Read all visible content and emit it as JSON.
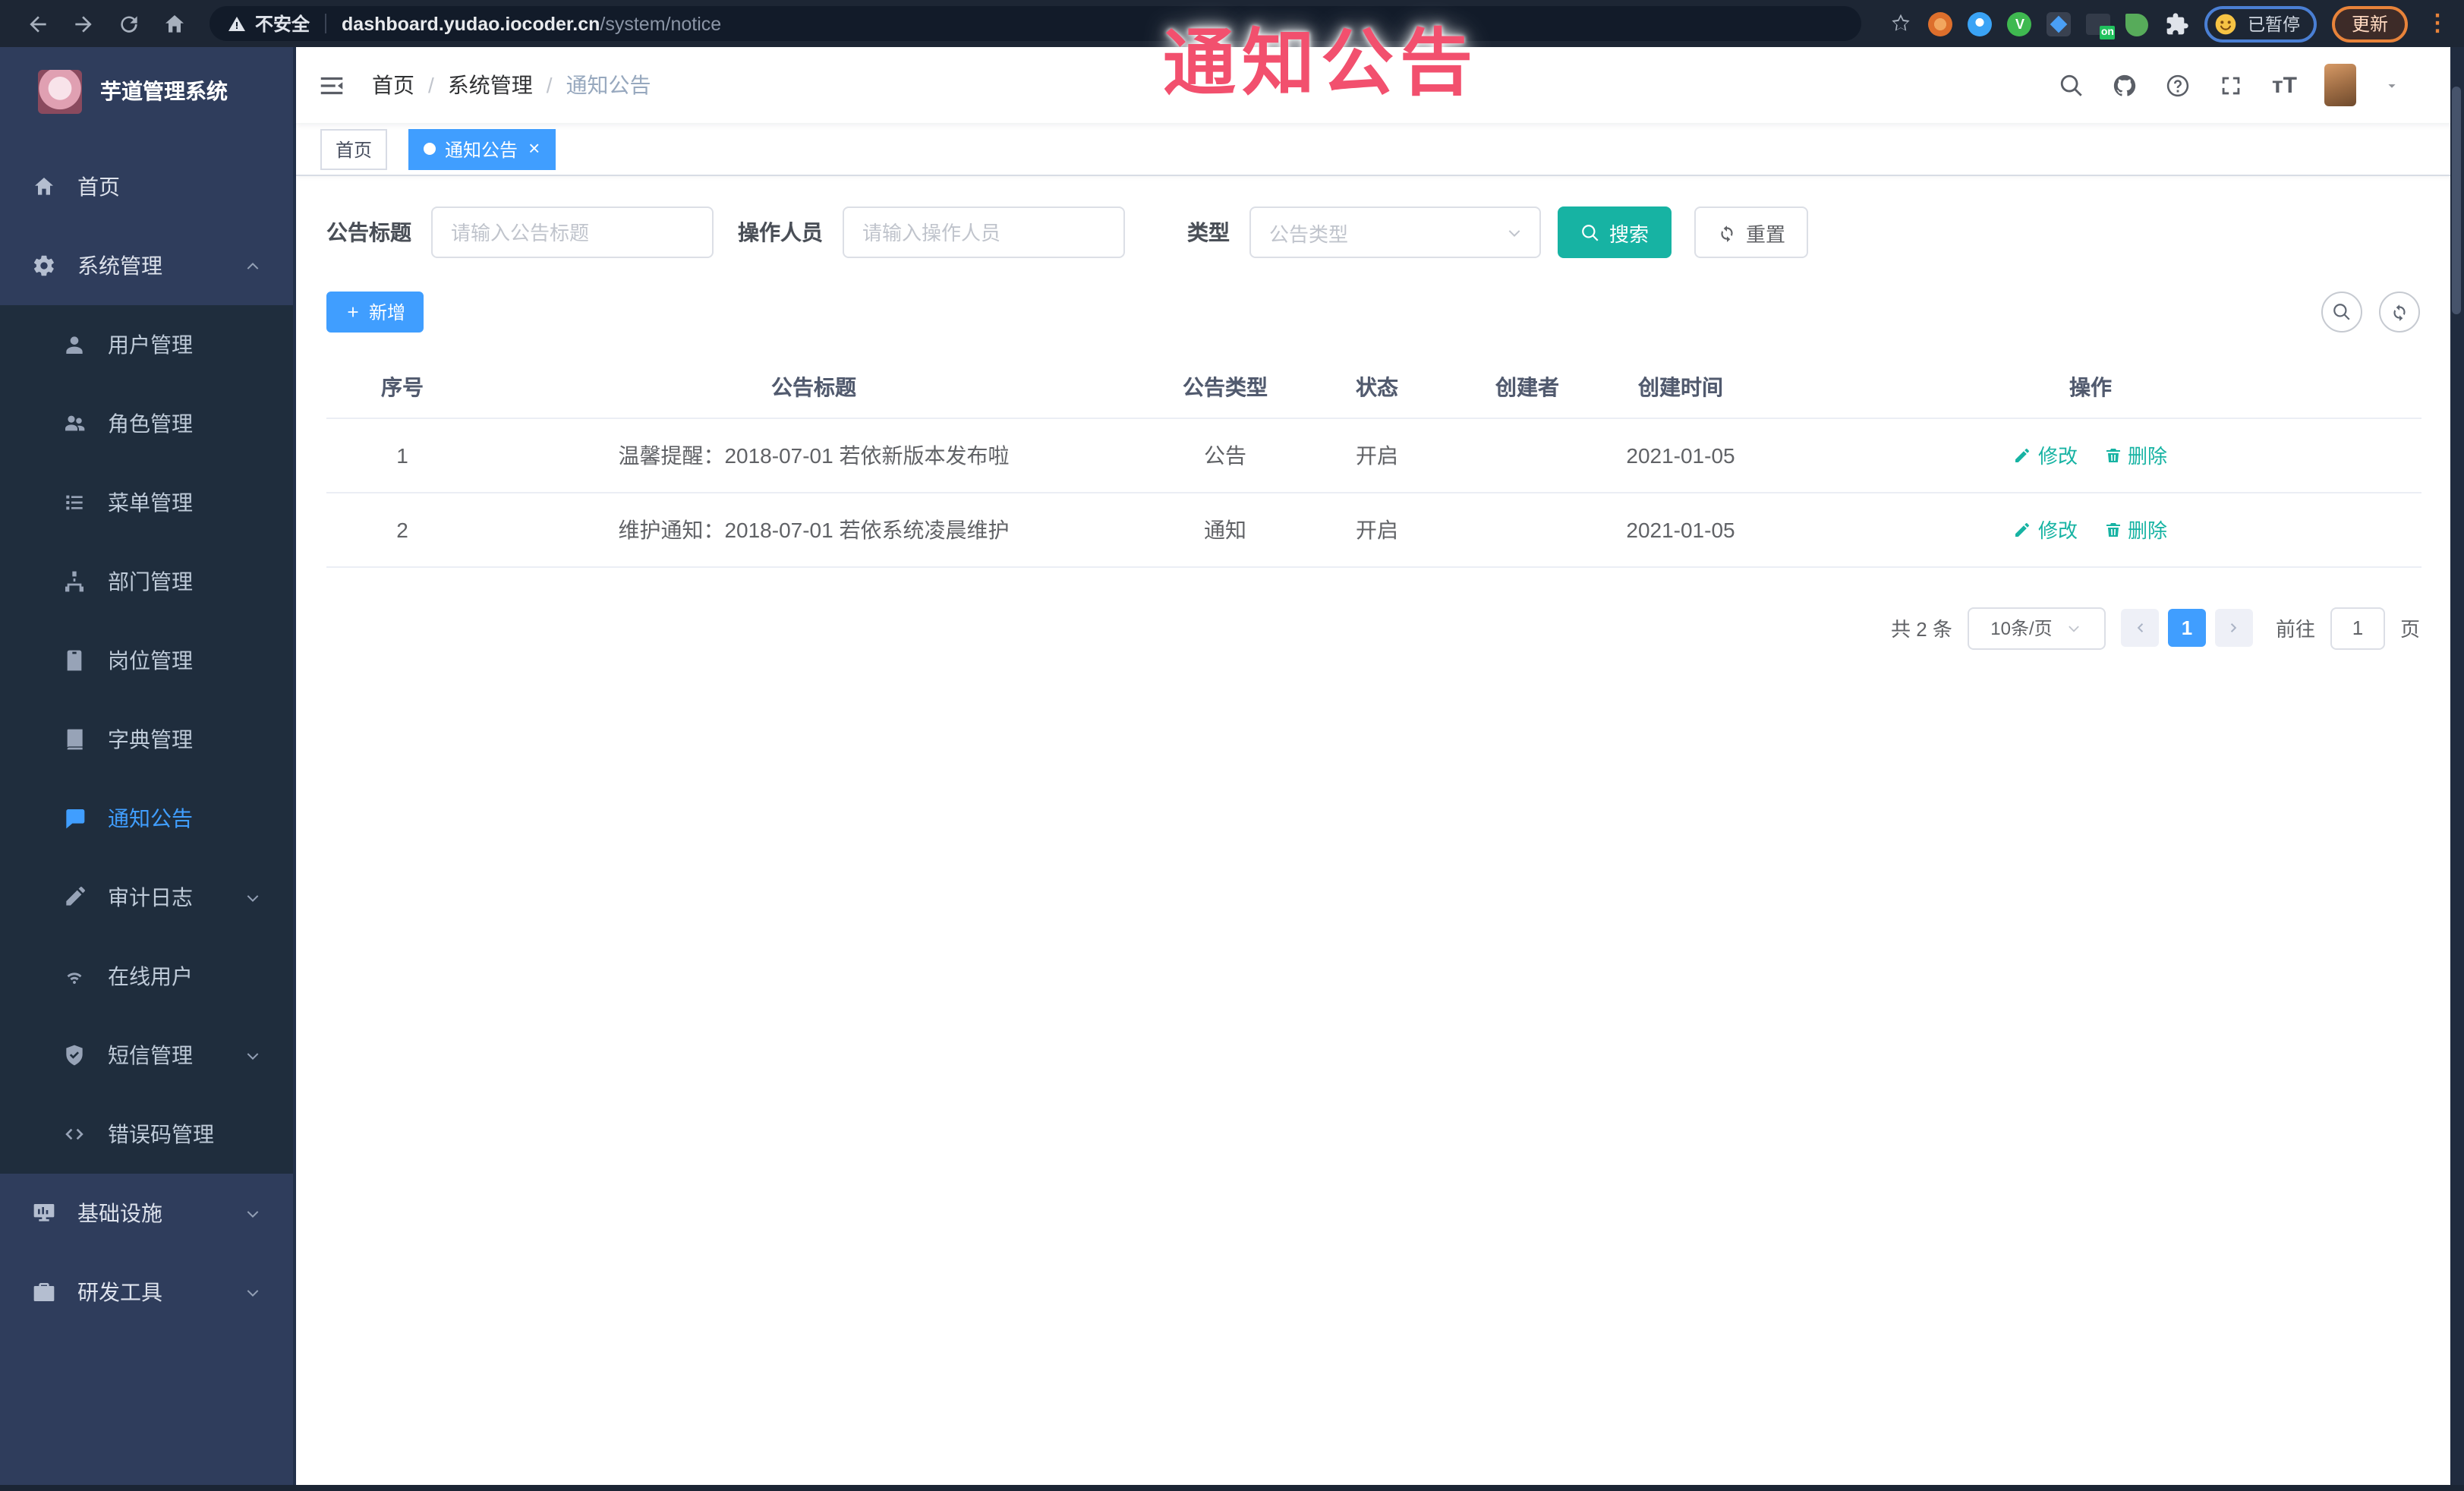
{
  "browser": {
    "security_label": "不安全",
    "url_domain": "dashboard.yudao.iocoder.cn",
    "url_path": "/system/notice",
    "extension_badge": "on",
    "profile_status": "已暂停",
    "update_label": "更新",
    "kebab": "⋮"
  },
  "overlay_title": "通知公告",
  "sidebar": {
    "app_title": "芋道管理系统",
    "items": [
      {
        "id": "home",
        "label": "首页",
        "icon": "home",
        "level": 1
      },
      {
        "id": "system-management",
        "label": "系统管理",
        "icon": "gear",
        "level": 1,
        "caret": "up"
      },
      {
        "id": "user-management",
        "label": "用户管理",
        "icon": "user",
        "level": 2
      },
      {
        "id": "role-management",
        "label": "角色管理",
        "icon": "users",
        "level": 2
      },
      {
        "id": "menu-management",
        "label": "菜单管理",
        "icon": "list",
        "level": 2
      },
      {
        "id": "dept-management",
        "label": "部门管理",
        "icon": "tree",
        "level": 2
      },
      {
        "id": "post-management",
        "label": "岗位管理",
        "icon": "badge",
        "level": 2
      },
      {
        "id": "dict-management",
        "label": "字典管理",
        "icon": "book",
        "level": 2
      },
      {
        "id": "notice-announcement",
        "label": "通知公告",
        "icon": "announce",
        "level": 2,
        "active": true
      },
      {
        "id": "audit-log",
        "label": "审计日志",
        "icon": "edit",
        "level": 2,
        "caret": "down"
      },
      {
        "id": "online-users",
        "label": "在线用户",
        "icon": "online",
        "level": 2
      },
      {
        "id": "sms-management",
        "label": "短信管理",
        "icon": "shield",
        "level": 2,
        "caret": "down"
      },
      {
        "id": "error-code-management",
        "label": "错误码管理",
        "icon": "code",
        "level": 2
      },
      {
        "id": "infrastructure",
        "label": "基础设施",
        "icon": "monitor",
        "level": 1,
        "caret": "down"
      },
      {
        "id": "dev-tools",
        "label": "研发工具",
        "icon": "briefcase",
        "level": 1,
        "caret": "down"
      }
    ]
  },
  "navbar": {
    "breadcrumb": [
      "首页",
      "系统管理",
      "通知公告"
    ]
  },
  "tabs": [
    {
      "label": "首页",
      "active": false
    },
    {
      "label": "通知公告",
      "active": true,
      "close": "×"
    }
  ],
  "filters": {
    "title_label": "公告标题",
    "title_placeholder": "请输入公告标题",
    "operator_label": "操作人员",
    "operator_placeholder": "请输入操作人员",
    "type_label": "类型",
    "type_placeholder": "公告类型",
    "search_label": "搜索",
    "reset_label": "重置"
  },
  "toolbar": {
    "add_label": "新增"
  },
  "table": {
    "columns": [
      "序号",
      "公告标题",
      "公告类型",
      "状态",
      "创建者",
      "创建时间",
      "操作"
    ],
    "rows": [
      {
        "no": "1",
        "title": "温馨提醒：2018-07-01 若依新版本发布啦",
        "type": "公告",
        "status": "开启",
        "creator": "",
        "created": "2021-01-05"
      },
      {
        "no": "2",
        "title": "维护通知：2018-07-01 若依系统凌晨维护",
        "type": "通知",
        "status": "开启",
        "creator": "",
        "created": "2021-01-05"
      }
    ],
    "edit_label": "修改",
    "delete_label": "删除"
  },
  "pagination": {
    "total": "共 2 条",
    "page_size": "10条/页",
    "page": "1",
    "goto_label": "前往",
    "goto_value": "1",
    "unit": "页"
  },
  "colors": {
    "primary": "#409eff",
    "teal": "#17b3a3",
    "overlay_pink": "#f2506e",
    "sidebar_bg": "#2f3d5c",
    "submenu_bg": "#1f2d3d",
    "chrome_bg": "#1d2634"
  }
}
